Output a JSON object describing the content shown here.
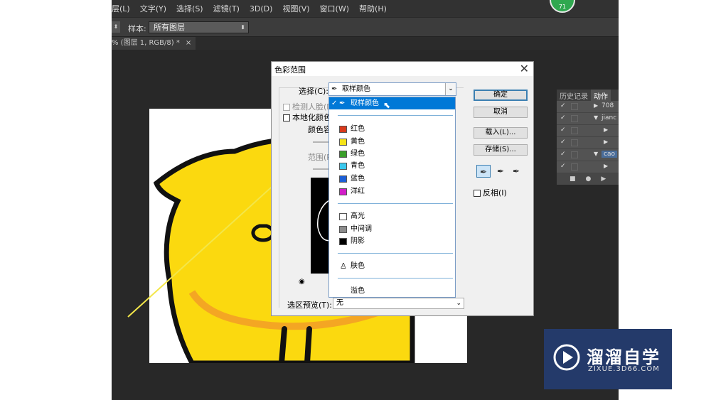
{
  "menubar": {
    "items": [
      "层(L)",
      "文字(Y)",
      "选择(S)",
      "滤镜(T)",
      "3D(D)",
      "视图(V)",
      "窗口(W)",
      "帮助(H)"
    ]
  },
  "badge": {
    "number": "71"
  },
  "options_bar": {
    "sample_label": "样本:",
    "sample_value": "所有图层"
  },
  "document_tab": {
    "title": "% (图层 1, RGB/8) *",
    "close": "×"
  },
  "history_panel": {
    "tabs": [
      "历史记录",
      "动作"
    ],
    "rows": [
      "708",
      "jianc",
      "",
      "",
      "cao",
      ""
    ]
  },
  "dialog": {
    "title": "色彩范围",
    "close_glyph": "✕",
    "select_label": "选择(C):",
    "select_value": "取样颜色",
    "detect_faces": "检测人脸(D",
    "localized": "本地化颜色",
    "fuzziness": "颜色容",
    "range": "范围(R",
    "buttons": {
      "ok": "确定",
      "cancel": "取消",
      "load": "载入(L)...",
      "save": "存储(S)..."
    },
    "invert_label": "反相(I)",
    "preview_label": "选区预览(T):",
    "preview_value": "无"
  },
  "dropdown": {
    "items": [
      {
        "label": "取样颜色",
        "color": "",
        "selected": true
      },
      {
        "label": "红色",
        "color": "#d93a1b"
      },
      {
        "label": "黄色",
        "color": "#f5e318"
      },
      {
        "label": "绿色",
        "color": "#3a9e2a"
      },
      {
        "label": "青色",
        "color": "#3ac8ee"
      },
      {
        "label": "蓝色",
        "color": "#1c5fd6"
      },
      {
        "label": "洋红",
        "color": "#d21ec8"
      },
      {
        "label": "高光",
        "color": "#ffffff"
      },
      {
        "label": "中间调",
        "color": "#8c8c8c"
      },
      {
        "label": "阴影",
        "color": "#000000"
      },
      {
        "label": "肤色",
        "color": ""
      },
      {
        "label": "溢色",
        "color": ""
      }
    ]
  },
  "watermark": {
    "title": "溜溜自学",
    "subtitle": "ZIXUE.3D66.COM"
  },
  "colors": {
    "ps_bg": "#282828",
    "chick_yellow": "#fbd90f",
    "accent_blue": "#0078d7",
    "watermark_bg": "#243a6a",
    "guide_line": "#f3e64a"
  }
}
